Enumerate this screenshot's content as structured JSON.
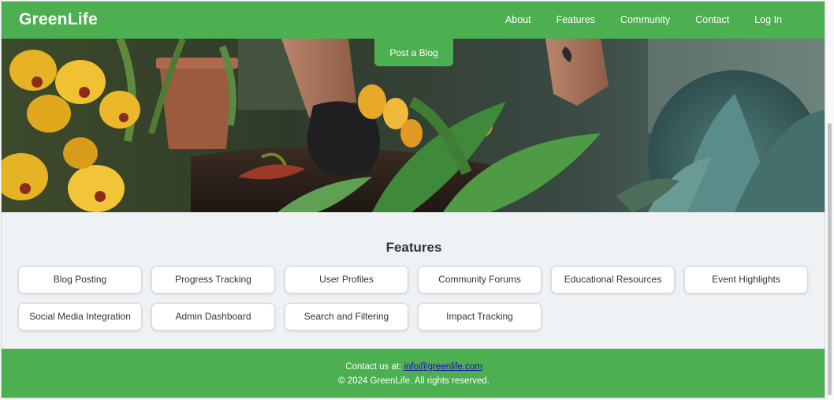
{
  "brand": "GreenLife",
  "nav": {
    "links": [
      "About",
      "Features",
      "Community",
      "Contact",
      "Log In"
    ]
  },
  "hero": {
    "cta_label": "Post a Blog"
  },
  "features": {
    "title": "Features",
    "items": [
      "Blog Posting",
      "Progress Tracking",
      "User Profiles",
      "Community Forums",
      "Educational Resources",
      "Event Highlights",
      "Social Media Integration",
      "Admin Dashboard",
      "Search and Filtering",
      "Impact Tracking"
    ]
  },
  "footer": {
    "contact_prefix": "Contact us at:",
    "email": "info@greenlife.com",
    "copyright": "© 2024 GreenLife. All rights reserved."
  },
  "colors": {
    "primary_green": "#4caf50",
    "page_background": "#eef2f5",
    "link_blue": "#1a0dab"
  }
}
